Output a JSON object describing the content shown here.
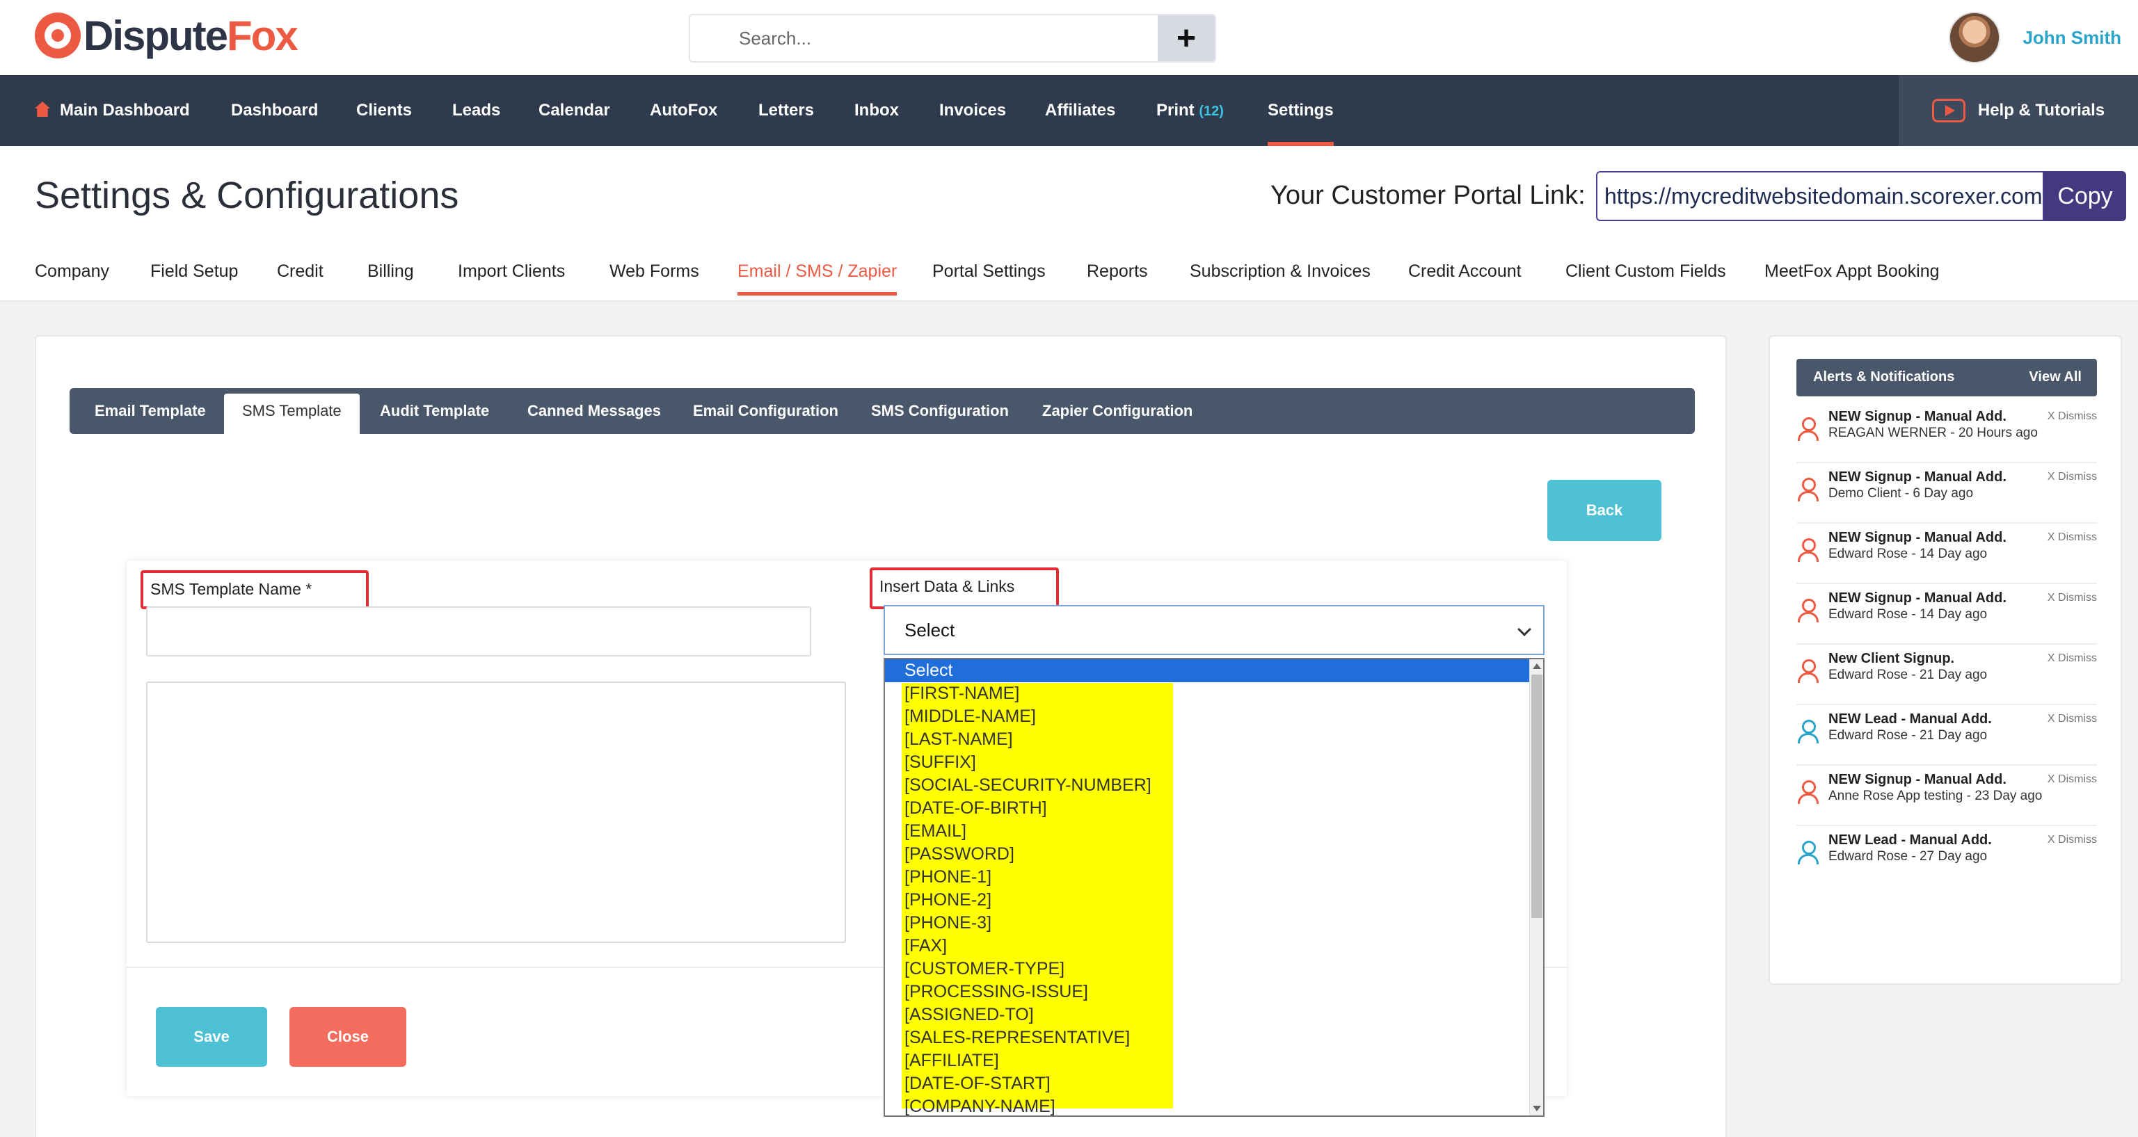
{
  "header": {
    "logo_part1": "Dispute",
    "logo_part2": "Fox",
    "search_placeholder": "Search...",
    "plus_label": "+",
    "user_name": "John Smith"
  },
  "nav": {
    "items": [
      "Main Dashboard",
      "Dashboard",
      "Clients",
      "Leads",
      "Calendar",
      "AutoFox",
      "Letters",
      "Inbox",
      "Invoices",
      "Affiliates",
      "Print",
      "Settings"
    ],
    "print_count": "(12)",
    "help_label": "Help & Tutorials"
  },
  "page": {
    "title": "Settings & Configurations",
    "portal_label": "Your Customer Portal Link:",
    "portal_url": "https://mycreditwebsitedomain.scorexer.com",
    "copy_label": "Copy"
  },
  "sub_tabs": [
    "Company",
    "Field Setup",
    "Credit",
    "Billing",
    "Import Clients",
    "Web Forms",
    "Email / SMS / Zapier",
    "Portal Settings",
    "Reports",
    "Subscription & Invoices",
    "Credit Account",
    "Client Custom Fields",
    "MeetFox Appt Booking"
  ],
  "template_tabs": [
    "Email Template",
    "SMS Template",
    "Audit Template",
    "Canned Messages",
    "Email Configuration",
    "SMS Configuration",
    "Zapier Configuration"
  ],
  "form": {
    "back_label": "Back",
    "name_label": "SMS Template Name *",
    "insert_label": "Insert Data & Links",
    "select_value": "Select",
    "save_label": "Save",
    "close_label": "Close"
  },
  "dropdown": {
    "options": [
      "Select",
      "[FIRST-NAME]",
      "[MIDDLE-NAME]",
      "[LAST-NAME]",
      "[SUFFIX]",
      "[SOCIAL-SECURITY-NUMBER]",
      "[DATE-OF-BIRTH]",
      "[EMAIL]",
      "[PASSWORD]",
      "[PHONE-1]",
      "[PHONE-2]",
      "[PHONE-3]",
      "[FAX]",
      "[CUSTOMER-TYPE]",
      "[PROCESSING-ISSUE]",
      "[ASSIGNED-TO]",
      "[SALES-REPRESENTATIVE]",
      "[AFFILIATE]",
      "[DATE-OF-START]",
      "[COMPANY-NAME]"
    ],
    "highlight_color": "#ffff00",
    "selected_color": "#1f6ed9"
  },
  "alerts": {
    "title": "Alerts & Notifications",
    "view_all": "View All",
    "dismiss_label": "X Dismiss",
    "items": [
      {
        "title": "NEW Signup - Manual Add.",
        "sub": "REAGAN WERNER - 20 Hours ago",
        "icon": "red"
      },
      {
        "title": "NEW Signup - Manual Add.",
        "sub": "Demo Client - 6 Day ago",
        "icon": "red"
      },
      {
        "title": "NEW Signup - Manual Add.",
        "sub": "Edward Rose - 14 Day ago",
        "icon": "red"
      },
      {
        "title": "NEW Signup - Manual Add.",
        "sub": "Edward Rose - 14 Day ago",
        "icon": "red"
      },
      {
        "title": "New Client Signup.",
        "sub": "Edward Rose - 21 Day ago",
        "icon": "red"
      },
      {
        "title": "NEW Lead - Manual Add.",
        "sub": "Edward Rose - 21 Day ago",
        "icon": "blue"
      },
      {
        "title": "NEW Signup - Manual Add.",
        "sub": "Anne Rose App testing - 23 Day ago",
        "icon": "red"
      },
      {
        "title": "NEW Lead - Manual Add.",
        "sub": "Edward Rose - 27 Day ago",
        "icon": "blue"
      }
    ]
  },
  "colors": {
    "brand_orange": "#ec5a43",
    "nav_bg": "#2f3a4d",
    "accent_teal": "#4ec0d3",
    "close_red": "#f36c5e",
    "copy_purple": "#43397f"
  }
}
